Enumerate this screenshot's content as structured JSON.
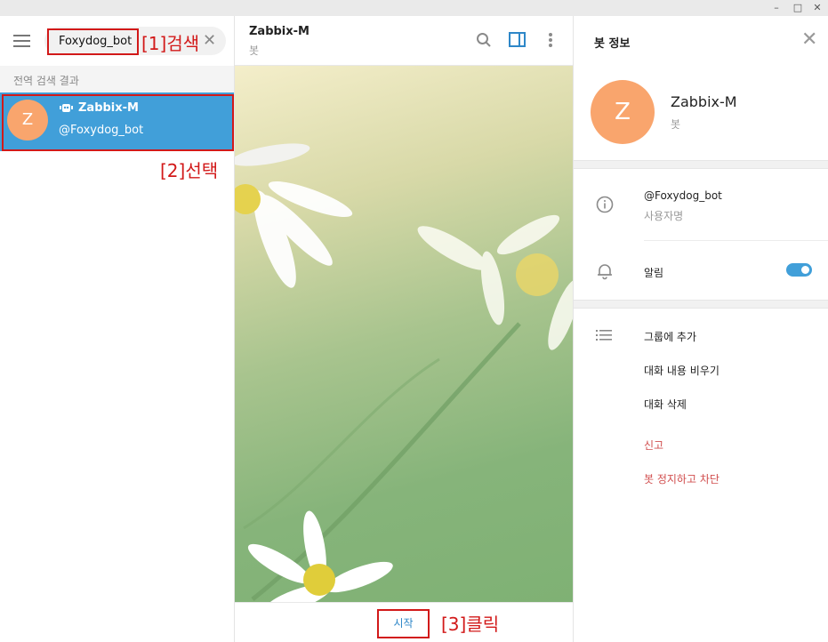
{
  "window": {
    "minimize": "–",
    "maximize": "□",
    "close": "✕"
  },
  "sidebar": {
    "search_value": "Foxydog_bot",
    "search_clear": "✕",
    "section_header": "전역 검색 결과",
    "result": {
      "avatar_letter": "Z",
      "name": "Zabbix-M",
      "username": "@Foxydog_bot"
    }
  },
  "annotations": {
    "step1": "[1]검색",
    "step2": "[2]선택",
    "step3": "[3]클릭"
  },
  "chat": {
    "title": "Zabbix-M",
    "subtitle": "봇",
    "start_label": "시작"
  },
  "info": {
    "title": "봇 정보",
    "avatar_letter": "Z",
    "name": "Zabbix-M",
    "subtitle": "봇",
    "username": "@Foxydog_bot",
    "username_label": "사용자명",
    "notifications_label": "알림",
    "notifications_on": true,
    "actions": [
      "그룹에 추가",
      "대화 내용 비우기",
      "대화 삭제"
    ],
    "danger_actions": [
      "신고",
      "봇 정지하고 차단"
    ]
  },
  "colors": {
    "accent": "#419fd9",
    "annotation_red": "#d21919",
    "avatar": "#f9a56d",
    "danger": "#d14e4e"
  }
}
